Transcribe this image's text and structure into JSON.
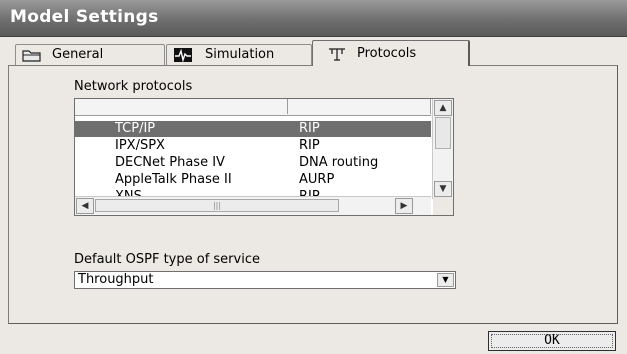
{
  "window": {
    "title": "Model Settings"
  },
  "tabs": [
    {
      "label": "General",
      "icon": "folder-icon",
      "active": false
    },
    {
      "label": "Simulation",
      "icon": "heart-monitor-icon",
      "active": false
    },
    {
      "label": "Protocols",
      "icon": "network-icon",
      "active": true
    }
  ],
  "protocols": {
    "section_label": "Network protocols",
    "rows": [
      {
        "protocol": "TCP/IP",
        "routing": "RIP",
        "selected": true
      },
      {
        "protocol": "IPX/SPX",
        "routing": "RIP",
        "selected": false
      },
      {
        "protocol": "DECNet Phase IV",
        "routing": "DNA routing",
        "selected": false
      },
      {
        "protocol": "AppleTalk Phase II",
        "routing": "AURP",
        "selected": false
      },
      {
        "protocol": "XNS",
        "routing": "RIP",
        "selected": false
      }
    ]
  },
  "ospf": {
    "label": "Default OSPF type of service",
    "selected_value": "Throughput"
  },
  "footer": {
    "ok_label": "OK"
  }
}
